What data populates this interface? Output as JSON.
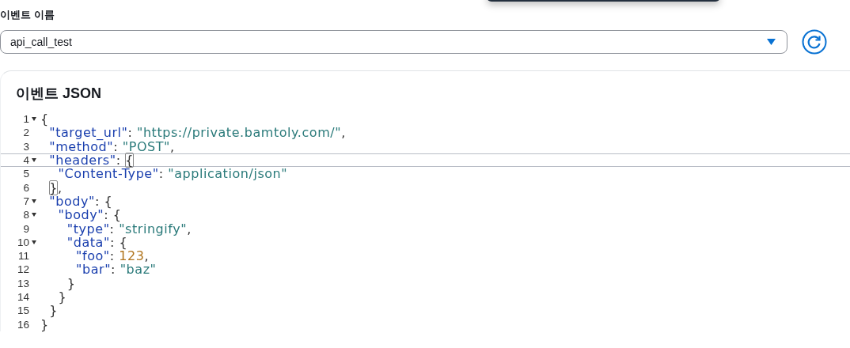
{
  "event_name": {
    "label": "이벤트 이름",
    "value": "api_call_test"
  },
  "editor": {
    "title": "이벤트 JSON",
    "lines": [
      {
        "number": "1",
        "foldable": true,
        "active": false,
        "tokens": [
          {
            "kind": "punct",
            "text": "{",
            "matched": false
          }
        ]
      },
      {
        "number": "2",
        "foldable": false,
        "active": false,
        "tokens": [
          {
            "kind": "key",
            "text": "  \"target_url\"",
            "matched": false
          },
          {
            "kind": "punct",
            "text": ": ",
            "matched": false
          },
          {
            "kind": "string",
            "text": "\"https://private.bamtoly.com/\"",
            "matched": false
          },
          {
            "kind": "punct",
            "text": ",",
            "matched": false
          }
        ]
      },
      {
        "number": "3",
        "foldable": false,
        "active": false,
        "tokens": [
          {
            "kind": "key",
            "text": "  \"method\"",
            "matched": false
          },
          {
            "kind": "punct",
            "text": ": ",
            "matched": false
          },
          {
            "kind": "string",
            "text": "\"POST\"",
            "matched": false
          },
          {
            "kind": "punct",
            "text": ",",
            "matched": false
          }
        ]
      },
      {
        "number": "4",
        "foldable": true,
        "active": true,
        "tokens": [
          {
            "kind": "key",
            "text": "  \"headers\"",
            "matched": false
          },
          {
            "kind": "punct",
            "text": ": ",
            "matched": false
          },
          {
            "kind": "punct",
            "text": "{",
            "matched": true
          }
        ]
      },
      {
        "number": "5",
        "foldable": false,
        "active": false,
        "tokens": [
          {
            "kind": "key",
            "text": "    \"Content-Type\"",
            "matched": false
          },
          {
            "kind": "punct",
            "text": ": ",
            "matched": false
          },
          {
            "kind": "string",
            "text": "\"application/json\"",
            "matched": false
          }
        ]
      },
      {
        "number": "6",
        "foldable": false,
        "active": false,
        "tokens": [
          {
            "kind": "punct",
            "text": "  }",
            "matched": true
          },
          {
            "kind": "punct",
            "text": ",",
            "matched": false
          }
        ]
      },
      {
        "number": "7",
        "foldable": true,
        "active": false,
        "tokens": [
          {
            "kind": "key",
            "text": "  \"body\"",
            "matched": false
          },
          {
            "kind": "punct",
            "text": ": {",
            "matched": false
          }
        ]
      },
      {
        "number": "8",
        "foldable": true,
        "active": false,
        "tokens": [
          {
            "kind": "key",
            "text": "    \"body\"",
            "matched": false
          },
          {
            "kind": "punct",
            "text": ": {",
            "matched": false
          }
        ]
      },
      {
        "number": "9",
        "foldable": false,
        "active": false,
        "tokens": [
          {
            "kind": "key",
            "text": "      \"type\"",
            "matched": false
          },
          {
            "kind": "punct",
            "text": ": ",
            "matched": false
          },
          {
            "kind": "string",
            "text": "\"stringify\"",
            "matched": false
          },
          {
            "kind": "punct",
            "text": ",",
            "matched": false
          }
        ]
      },
      {
        "number": "10",
        "foldable": true,
        "active": false,
        "tokens": [
          {
            "kind": "key",
            "text": "      \"data\"",
            "matched": false
          },
          {
            "kind": "punct",
            "text": ": {",
            "matched": false
          }
        ]
      },
      {
        "number": "11",
        "foldable": false,
        "active": false,
        "tokens": [
          {
            "kind": "key",
            "text": "        \"foo\"",
            "matched": false
          },
          {
            "kind": "punct",
            "text": ": ",
            "matched": false
          },
          {
            "kind": "number",
            "text": "123",
            "matched": false
          },
          {
            "kind": "punct",
            "text": ",",
            "matched": false
          }
        ]
      },
      {
        "number": "12",
        "foldable": false,
        "active": false,
        "tokens": [
          {
            "kind": "key",
            "text": "        \"bar\"",
            "matched": false
          },
          {
            "kind": "punct",
            "text": ": ",
            "matched": false
          },
          {
            "kind": "string",
            "text": "\"baz\"",
            "matched": false
          }
        ]
      },
      {
        "number": "13",
        "foldable": false,
        "active": false,
        "tokens": [
          {
            "kind": "punct",
            "text": "      }",
            "matched": false
          }
        ]
      },
      {
        "number": "14",
        "foldable": false,
        "active": false,
        "tokens": [
          {
            "kind": "punct",
            "text": "    }",
            "matched": false
          }
        ]
      },
      {
        "number": "15",
        "foldable": false,
        "active": false,
        "tokens": [
          {
            "kind": "punct",
            "text": "  }",
            "matched": false
          }
        ]
      },
      {
        "number": "16",
        "foldable": false,
        "active": false,
        "tokens": [
          {
            "kind": "punct",
            "text": "}",
            "matched": false
          }
        ]
      }
    ]
  }
}
